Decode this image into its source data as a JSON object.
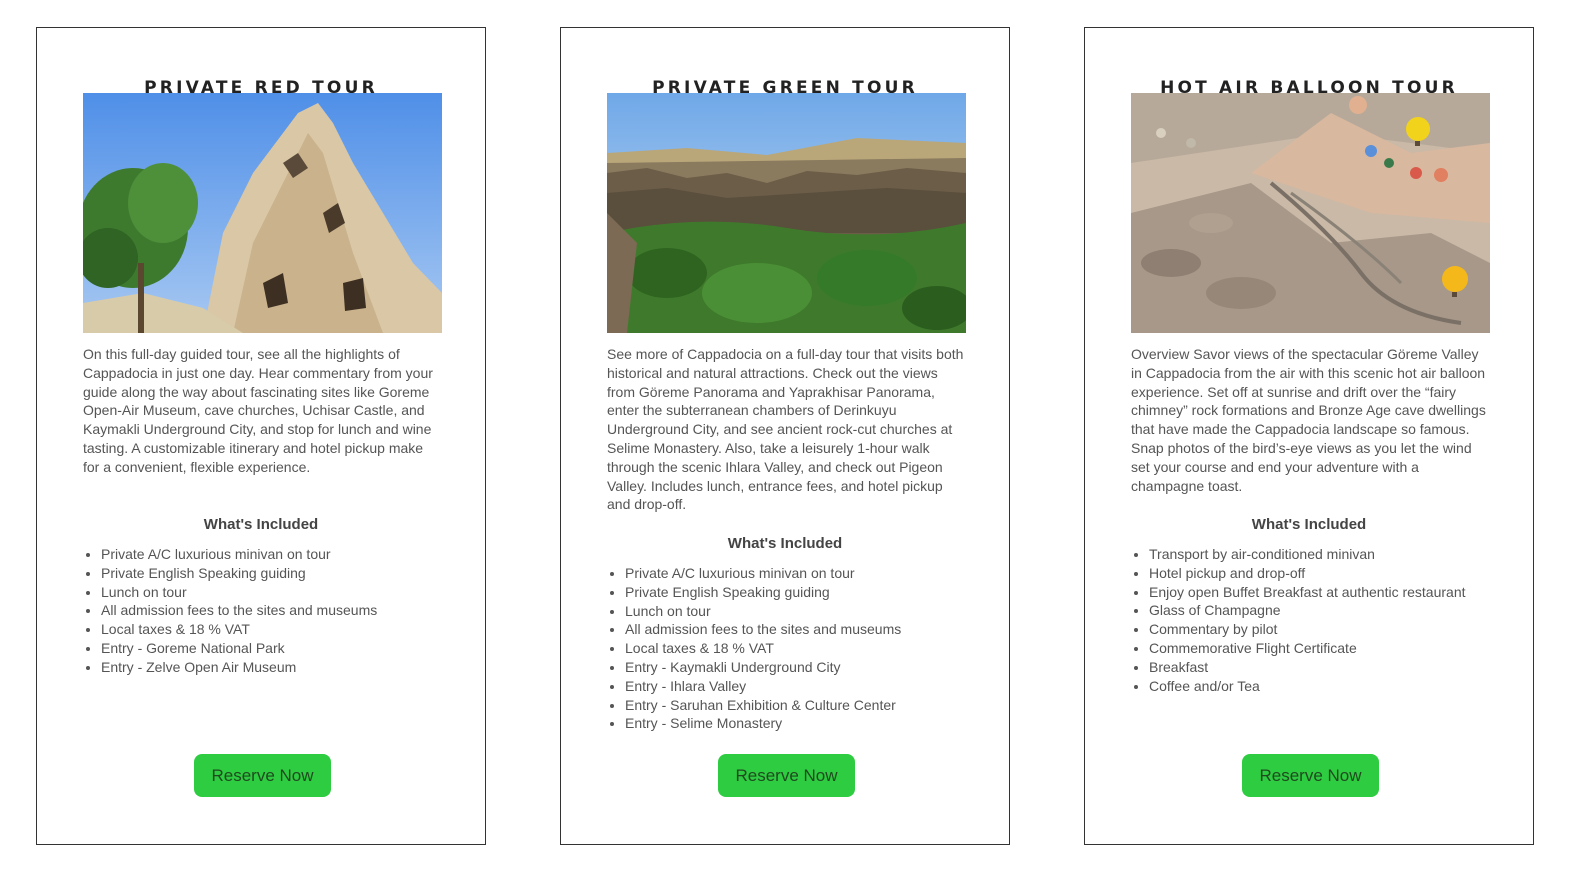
{
  "cards": [
    {
      "title": "PRIVATE RED TOUR",
      "image_subject": "fairy-chimney-rock",
      "description": "On this full-day guided tour, see all the highlights of Cappadocia in just one day. Hear commentary from your guide along the way about fascinating sites like Goreme Open-Air Museum, cave churches, Uchisar Castle, and Kaymakli Underground City, and stop for lunch and wine tasting. A customizable itinerary and hotel pickup make for a convenient, flexible experience.",
      "included_title": "What's Included",
      "items": [
        "Private A/C luxurious minivan on tour",
        "Private English Speaking guiding",
        "Lunch on tour",
        "All admission fees to the sites and museums",
        "Local taxes & 18 % VAT",
        "Entry - Goreme National Park",
        "Entry - Zelve Open Air Museum"
      ],
      "button": "Reserve Now"
    },
    {
      "title": "PRIVATE GREEN TOUR",
      "image_subject": "ihlara-valley",
      "description": "See more of Cappadocia on a full-day tour that visits both historical and natural attractions. Check out the views from Göreme Panorama and Yaprakhisar Panorama, enter the subterranean chambers of Derinkuyu Underground City, and see ancient rock-cut churches at Selime Monastery. Also, take a leisurely 1-hour walk through the scenic Ihlara Valley, and check out Pigeon Valley. Includes lunch, entrance fees, and hotel pickup and drop-off.",
      "included_title": "What's Included",
      "items": [
        "Private A/C luxurious minivan on tour",
        "Private English Speaking guiding",
        "Lunch on tour",
        "All admission fees to the sites and museums",
        "Local taxes & 18 % VAT",
        "Entry - Kaymakli Underground City",
        "Entry - Ihlara Valley",
        "Entry - Saruhan Exhibition & Culture Center",
        "Entry - Selime Monastery"
      ],
      "button": "Reserve Now"
    },
    {
      "title": "HOT AIR BALLOON TOUR",
      "image_subject": "balloons-over-valley",
      "description": "Overview Savor views of the spectacular Göreme Valley in Cappadocia from the air with this scenic hot air balloon experience. Set off at sunrise and drift over the “fairy chimney” rock formations and Bronze Age cave dwellings that have made the Cappadocia landscape so famous. Snap photos of the bird’s-eye views as you let the wind set your course and end your adventure with a champagne toast.",
      "included_title": "What's Included",
      "items": [
        "Transport by air-conditioned minivan",
        "Hotel pickup and drop-off",
        "Enjoy open Buffet Breakfast at authentic restaurant",
        "Glass of Champagne",
        "Commentary by pilot",
        "Commemorative Flight Certificate",
        "Breakfast",
        "Coffee and/or Tea"
      ],
      "button": "Reserve Now"
    }
  ],
  "colors": {
    "button_bg": "#2ecc40",
    "button_text": "#1f4a1f",
    "border": "#333333"
  }
}
